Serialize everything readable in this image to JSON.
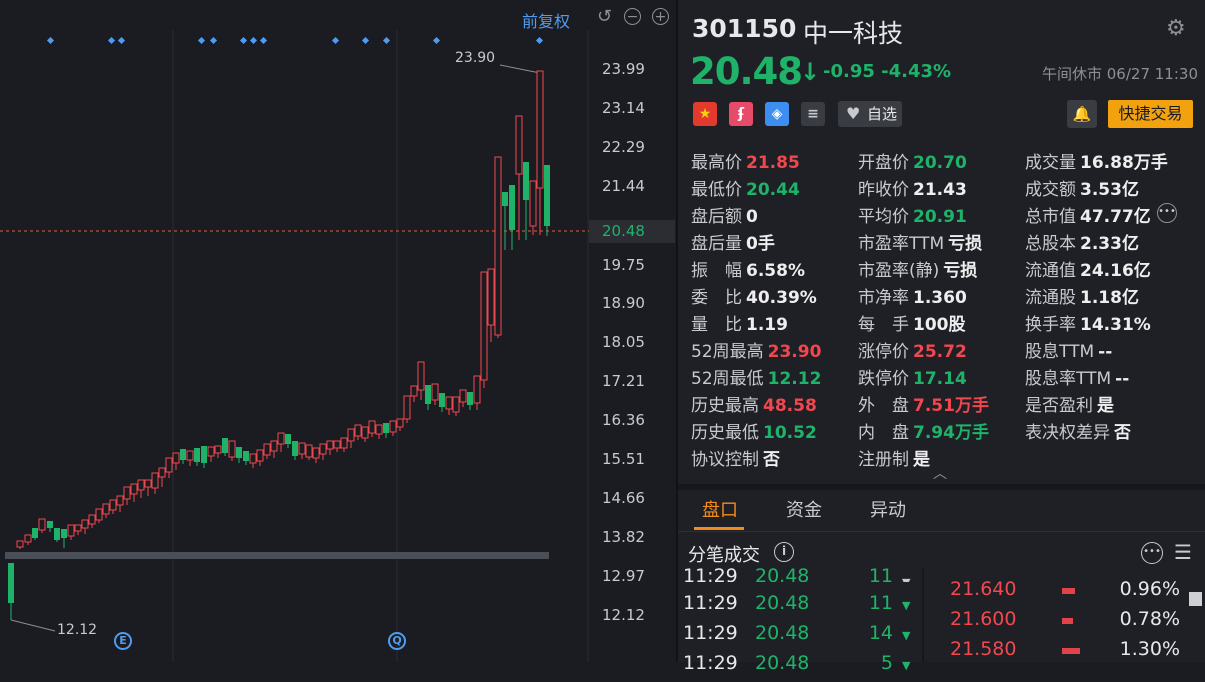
{
  "chart": {
    "adjust_label": "前复权",
    "y_axis_labels": [
      "23.99",
      "23.14",
      "22.29",
      "21.44",
      "20.48",
      "19.75",
      "18.90",
      "18.05",
      "17.21",
      "16.36",
      "15.51",
      "14.66",
      "13.82",
      "12.97",
      "12.12"
    ],
    "current_price_label": "20.48",
    "high_marker": "23.90",
    "low_marker": "12.12",
    "event_markers": [
      "E",
      "Q"
    ]
  },
  "stock": {
    "code": "301150",
    "name": "中一科技",
    "price": "20.48",
    "change": "-0.95",
    "change_pct": "-4.43%",
    "status": "午间休市 06/27 11:30",
    "flag_badge": "★",
    "lightning_badge": "ʄ",
    "watchlist_label": "自选",
    "quick_trade_label": "快捷交易"
  },
  "stats": {
    "col1": [
      {
        "label": "最高价",
        "value": "21.85",
        "color": "red"
      },
      {
        "label": "最低价",
        "value": "20.44",
        "color": "green"
      },
      {
        "label": "盘后额",
        "value": "0",
        "color": "white"
      },
      {
        "label": "盘后量",
        "value": "0手",
        "color": "white"
      },
      {
        "label": "振　幅",
        "value": "6.58%",
        "color": "white"
      },
      {
        "label": "委　比",
        "value": "40.39%",
        "color": "white"
      },
      {
        "label": "量　比",
        "value": "1.19",
        "color": "white"
      },
      {
        "label": "52周最高",
        "value": "23.90",
        "color": "red"
      },
      {
        "label": "52周最低",
        "value": "12.12",
        "color": "green"
      },
      {
        "label": "历史最高",
        "value": "48.58",
        "color": "red"
      },
      {
        "label": "历史最低",
        "value": "10.52",
        "color": "green"
      },
      {
        "label": "协议控制",
        "value": "否",
        "color": "white"
      }
    ],
    "col2": [
      {
        "label": "开盘价",
        "value": "20.70",
        "color": "green"
      },
      {
        "label": "昨收价",
        "value": "21.43",
        "color": "white"
      },
      {
        "label": "平均价",
        "value": "20.91",
        "color": "green"
      },
      {
        "label": "市盈率TTM",
        "value": "亏损",
        "color": "white"
      },
      {
        "label": "市盈率(静)",
        "value": "亏损",
        "color": "white"
      },
      {
        "label": "市净率",
        "value": "1.360",
        "color": "white"
      },
      {
        "label": "每　手",
        "value": "100股",
        "color": "white"
      },
      {
        "label": "涨停价",
        "value": "25.72",
        "color": "red"
      },
      {
        "label": "跌停价",
        "value": "17.14",
        "color": "green"
      },
      {
        "label": "外　盘",
        "value": "7.51万手",
        "color": "red"
      },
      {
        "label": "内　盘",
        "value": "7.94万手",
        "color": "green"
      },
      {
        "label": "注册制",
        "value": "是",
        "color": "white"
      }
    ],
    "col3": [
      {
        "label": "成交量",
        "value": "16.88万手",
        "color": "white"
      },
      {
        "label": "成交额",
        "value": "3.53亿",
        "color": "white"
      },
      {
        "label": "总市值",
        "value": "47.77亿",
        "color": "white"
      },
      {
        "label": "总股本",
        "value": "2.33亿",
        "color": "white"
      },
      {
        "label": "流通值",
        "value": "24.16亿",
        "color": "white"
      },
      {
        "label": "流通股",
        "value": "1.18亿",
        "color": "white"
      },
      {
        "label": "换手率",
        "value": "14.31%",
        "color": "white"
      },
      {
        "label": "股息TTM",
        "value": "--",
        "color": "white"
      },
      {
        "label": "股息率TTM",
        "value": "--",
        "color": "white"
      },
      {
        "label": "是否盈利",
        "value": "是",
        "color": "white"
      },
      {
        "label": "表决权差异",
        "value": "否",
        "color": "white"
      }
    ]
  },
  "tabs": [
    {
      "label": "盘口",
      "active": true
    },
    {
      "label": "资金",
      "active": false
    },
    {
      "label": "异动",
      "active": false
    }
  ],
  "ticks": {
    "title": "分笔成交",
    "rows": [
      {
        "time": "11:29",
        "price": "20.48",
        "vol": "11"
      },
      {
        "time": "11:29",
        "price": "20.48",
        "vol": "11"
      },
      {
        "time": "11:29",
        "price": "20.48",
        "vol": "14"
      },
      {
        "time": "11:29",
        "price": "20.48",
        "vol": "5"
      }
    ]
  },
  "levels": [
    {
      "price": "21.640",
      "pct": "0.96%",
      "share": 0.96
    },
    {
      "price": "21.600",
      "pct": "0.78%",
      "share": 0.78
    },
    {
      "price": "21.580",
      "pct": "1.30%",
      "share": 1.3
    }
  ],
  "colors": {
    "up": "#f0484e",
    "down": "#1fb36a",
    "accent": "#f28b1e",
    "link": "#4f9cf0",
    "quick": "#f2a20f"
  }
}
